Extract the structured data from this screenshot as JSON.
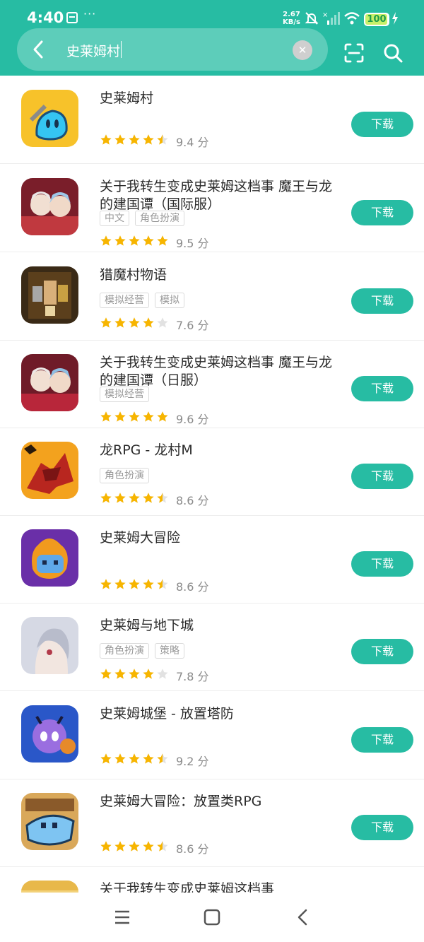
{
  "status_bar": {
    "time": "4:40",
    "more": "···",
    "net_rate": "2.67",
    "net_unit": "KB/s",
    "battery": "100"
  },
  "search": {
    "query": "史莱姆村"
  },
  "icons": {
    "back": "back-arrow-icon",
    "clear": "clear-icon",
    "scan": "scan-icon",
    "search": "search-icon"
  },
  "colors": {
    "brand": "#27bca3",
    "star": "#f7b500"
  },
  "results": [
    {
      "name": "史莱姆村",
      "tags": [],
      "rating": 4.5,
      "score": "9.4 分",
      "button": "下载"
    },
    {
      "name": "关于我转生变成史莱姆这档事 魔王与龙的建国谭（国际服）",
      "tags": [
        "中文",
        "角色扮演"
      ],
      "rating": 5,
      "score": "9.5 分",
      "button": "下载"
    },
    {
      "name": "猎魔村物语",
      "tags": [
        "模拟经营",
        "模拟"
      ],
      "rating": 4,
      "score": "7.6 分",
      "button": "下载"
    },
    {
      "name": "关于我转生变成史莱姆这档事 魔王与龙的建国谭（日服）",
      "tags": [
        "模拟经营"
      ],
      "rating": 5,
      "score": "9.6 分",
      "button": "下载"
    },
    {
      "name": "龙RPG - 龙村M",
      "tags": [
        "角色扮演"
      ],
      "rating": 4.5,
      "score": "8.6 分",
      "button": "下载"
    },
    {
      "name": "史莱姆大冒险",
      "tags": [],
      "rating": 4.5,
      "score": "8.6 分",
      "button": "下载"
    },
    {
      "name": "史莱姆与地下城",
      "tags": [
        "角色扮演",
        "策略"
      ],
      "rating": 4,
      "score": "7.8 分",
      "button": "下载"
    },
    {
      "name": "史莱姆城堡 - 放置塔防",
      "tags": [],
      "rating": 4.5,
      "score": "9.2 分",
      "button": "下载"
    },
    {
      "name": "史莱姆大冒险：放置类RPG",
      "tags": [],
      "rating": 4.5,
      "score": "8.6 分",
      "button": "下载"
    },
    {
      "name": "关于我转生变成史莱姆这档事",
      "tags": [],
      "rating": null,
      "score": "",
      "button": ""
    }
  ],
  "nav": {
    "menu": "menu-icon",
    "home": "home-icon",
    "back": "back-icon"
  }
}
